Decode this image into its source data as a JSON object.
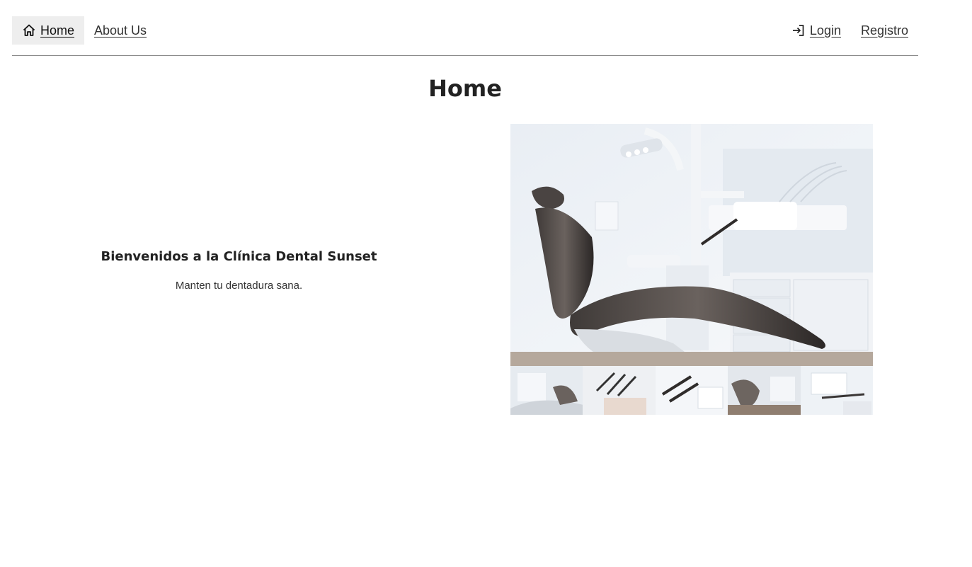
{
  "nav": {
    "home_label": "Home",
    "about_label": "About Us",
    "login_label": "Login",
    "register_label": "Registro"
  },
  "main": {
    "title": "Home",
    "welcome_heading": "Bienvenidos a la Clínica Dental Sunset",
    "welcome_text": "Manten tu dentadura sana."
  },
  "icons": {
    "home": "home-icon",
    "login": "login-icon"
  },
  "colors": {
    "nav_active_bg": "#eeeeee",
    "divider": "#8a8a8a",
    "chair": "#5f5753"
  }
}
